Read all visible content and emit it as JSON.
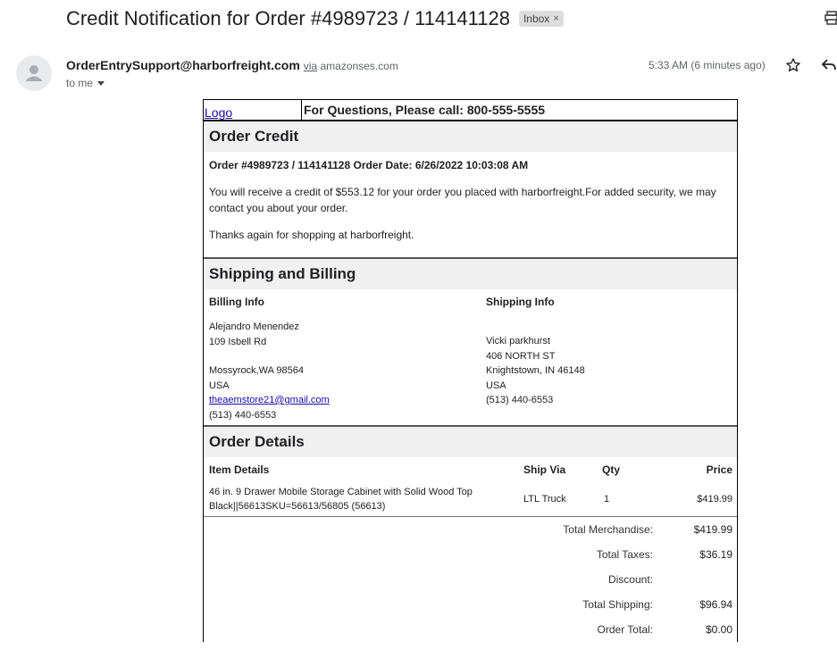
{
  "email": {
    "subject": "Credit Notification for Order #4989723 / 114141128",
    "label_chip": "Inbox",
    "chip_close": "×",
    "sender": "OrderEntrySupport@harborfreight.com",
    "via_word": "via",
    "via_domain": "amazonses.com",
    "recipient": "to me",
    "time": "5:33 AM (6 minutes ago)"
  },
  "body": {
    "logo_alt": "Logo",
    "phone_line": "For Questions, Please call: 800-555-5555",
    "order_credit": {
      "heading": "Order Credit",
      "order_line_prefix": "Order #4989723 / ",
      "order_line_bold": "114141128",
      "order_line_suffix": " Order Date: 6/26/2022 10:03:08 AM",
      "para1": "You will receive a credit of $553.12 for your order you placed with harborfreight.For added security, we may contact you about your order.",
      "para2": "Thanks again for shopping at harborfreight."
    },
    "shipping_billing": {
      "heading": "Shipping and Billing",
      "billing_title": "Billing Info",
      "shipping_title": "Shipping Info",
      "billing": {
        "name": "Alejandro Menendez",
        "street": "109 Isbell Rd",
        "city": "Mossyrock,WA 98564",
        "country": "USA",
        "email": "theaemstore21@gmail.com",
        "phone": "(513) 440-6553"
      },
      "shipping": {
        "name": "Vicki parkhurst",
        "street": "406 NORTH ST",
        "city": "Knightstown, IN 46148",
        "country": "USA",
        "phone": "(513) 440-6553"
      }
    },
    "order_details": {
      "heading": "Order Details",
      "columns": {
        "item": "Item Details",
        "via": "Ship Via",
        "qty": "Qty",
        "price": "Price"
      },
      "items": [
        {
          "description_line1": "46 in. 9 Drawer Mobile Storage Cabinet with Solid Wood Top",
          "description_line2": "Black||56613SKU=56613/56805 (56613)",
          "ship_via": "LTL Truck",
          "qty": "1",
          "price": "$419.99"
        }
      ],
      "totals": [
        {
          "label": "Total Merchandise:",
          "value": "$419.99"
        },
        {
          "label": "Total Taxes:",
          "value": "$36.19"
        },
        {
          "label": "Discount:",
          "value": ""
        },
        {
          "label": "Total Shipping:",
          "value": "$96.94"
        },
        {
          "label": "Order Total:",
          "value": "$0.00"
        }
      ]
    }
  }
}
